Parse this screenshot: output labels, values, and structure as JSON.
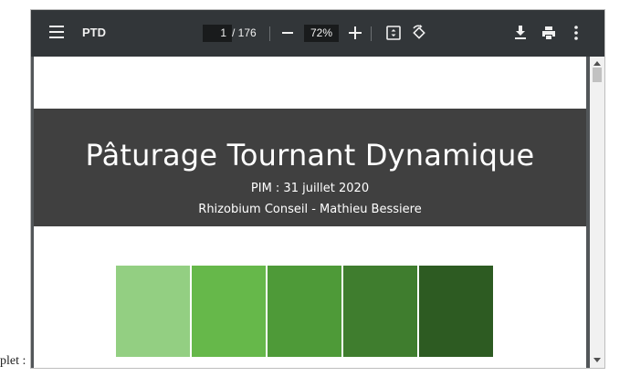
{
  "outer": {
    "partial_text": "plet :"
  },
  "toolbar": {
    "title": "PTD",
    "page_current": "1",
    "page_total": "/ 176",
    "zoom": "72%",
    "icons": [
      "menu-icon",
      "zoom-out-icon",
      "zoom-in-icon",
      "fit-page-icon",
      "rotate-icon",
      "download-icon",
      "print-icon",
      "more-vert-icon"
    ]
  },
  "slide": {
    "title": "Pâturage Tournant Dynamique",
    "subtitle1": "PIM : 31 juillet 2020",
    "subtitle2": "Rhizobium Conseil - Mathieu Bessiere",
    "banner_color": "#404040",
    "swatch_colors": [
      "#93cf82",
      "#66b84a",
      "#4e9a38",
      "#3f7d2e",
      "#2d5b22"
    ]
  }
}
